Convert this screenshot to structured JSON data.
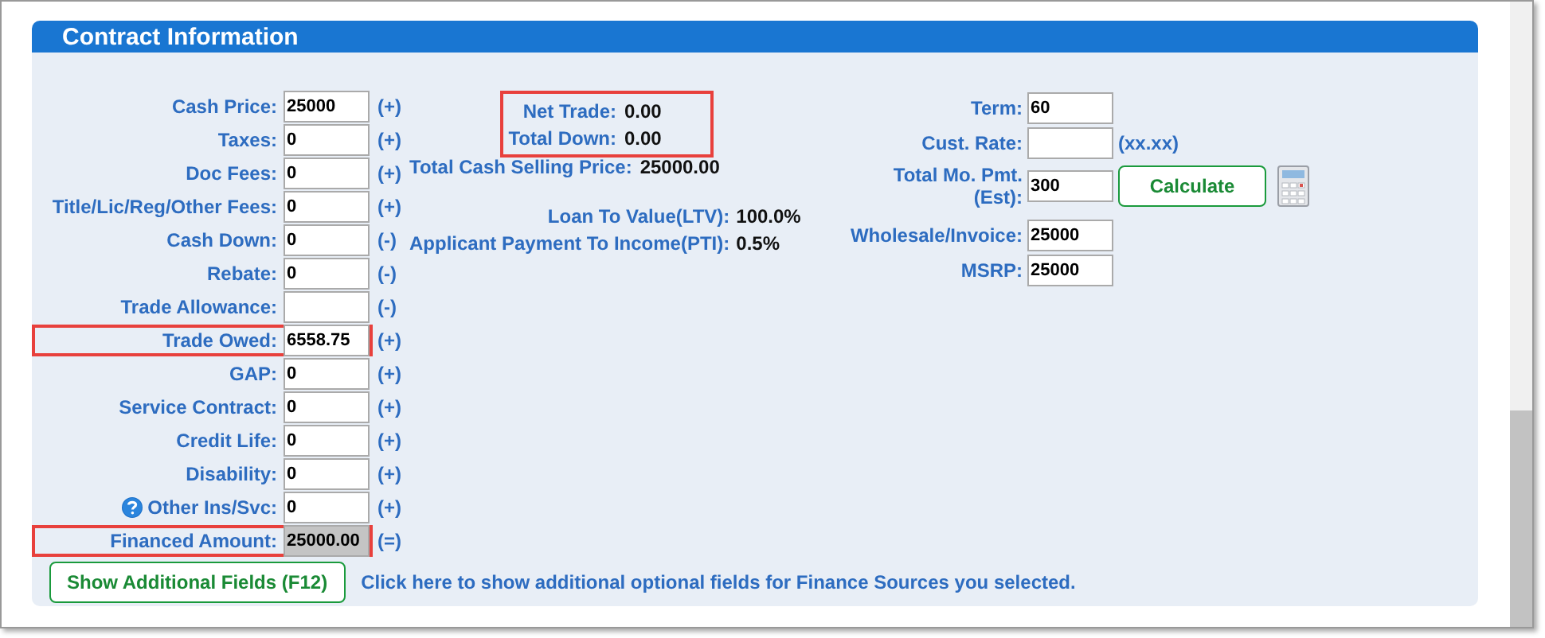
{
  "panel": {
    "title": "Contract Information"
  },
  "left_fields": [
    {
      "label": "Cash Price:",
      "value": "25000",
      "sign": "(+)",
      "kind": "input",
      "highlighted": false
    },
    {
      "label": "Taxes:",
      "value": "0",
      "sign": "(+)",
      "kind": "input",
      "highlighted": false
    },
    {
      "label": "Doc Fees:",
      "value": "0",
      "sign": "(+)",
      "kind": "input",
      "highlighted": false
    },
    {
      "label": "Title/Lic/Reg/Other Fees:",
      "value": "0",
      "sign": "(+)",
      "kind": "input",
      "highlighted": false
    },
    {
      "label": "Cash Down:",
      "value": "0",
      "sign": "(-)",
      "kind": "input",
      "highlighted": false
    },
    {
      "label": "Rebate:",
      "value": "0",
      "sign": "(-)",
      "kind": "input",
      "highlighted": false
    },
    {
      "label": "Trade Allowance:",
      "sign": "(-)",
      "kind": "input",
      "highlighted": false
    },
    {
      "label": "Trade Owed:",
      "value": "6558.75",
      "sign": "(+)",
      "kind": "input",
      "highlighted": true
    },
    {
      "label": "GAP:",
      "value": "0",
      "sign": "(+)",
      "kind": "input",
      "highlighted": false
    },
    {
      "label": "Service Contract:",
      "value": "0",
      "sign": "(+)",
      "kind": "input",
      "highlighted": false
    },
    {
      "label": "Credit Life:",
      "value": "0",
      "sign": "(+)",
      "kind": "input",
      "highlighted": false
    },
    {
      "label": "Disability:",
      "value": "0",
      "sign": "(+)",
      "kind": "input",
      "highlighted": false
    },
    {
      "label": "Other Ins/Svc:",
      "value": "0",
      "sign": "(+)",
      "kind": "input",
      "highlighted": false,
      "help": true
    },
    {
      "label": "Financed Amount:",
      "value": "25000.00",
      "sign": "(=)",
      "kind": "readonly",
      "highlighted": true
    }
  ],
  "trade_summary": {
    "highlighted": true,
    "rows": [
      {
        "label": "Net Trade:",
        "value": "0.00"
      },
      {
        "label": "Total Down:",
        "value": "0.00"
      }
    ]
  },
  "total_cash_selling_price": {
    "label": "Total Cash Selling Price:",
    "value": "25000.00"
  },
  "ratios": [
    {
      "label": "Loan To Value(LTV):",
      "value": "100.0%"
    },
    {
      "label": "Applicant Payment To Income(PTI):",
      "value": "0.5%"
    }
  ],
  "right_fields": [
    {
      "label": "Term:",
      "value": "60"
    },
    {
      "label": "Cust. Rate:",
      "note": "(xx.xx)"
    },
    {
      "label": "Total Mo. Pmt. (Est):",
      "value": "300",
      "button": "Calculate",
      "calculator": true
    },
    {
      "label": "Wholesale/Invoice:",
      "value": "25000"
    },
    {
      "label": "MSRP:",
      "value": "25000"
    }
  ],
  "footer": {
    "button": "Show Additional Fields (F12)",
    "hint": "Click here to show additional optional fields for Finance Sources you selected."
  }
}
